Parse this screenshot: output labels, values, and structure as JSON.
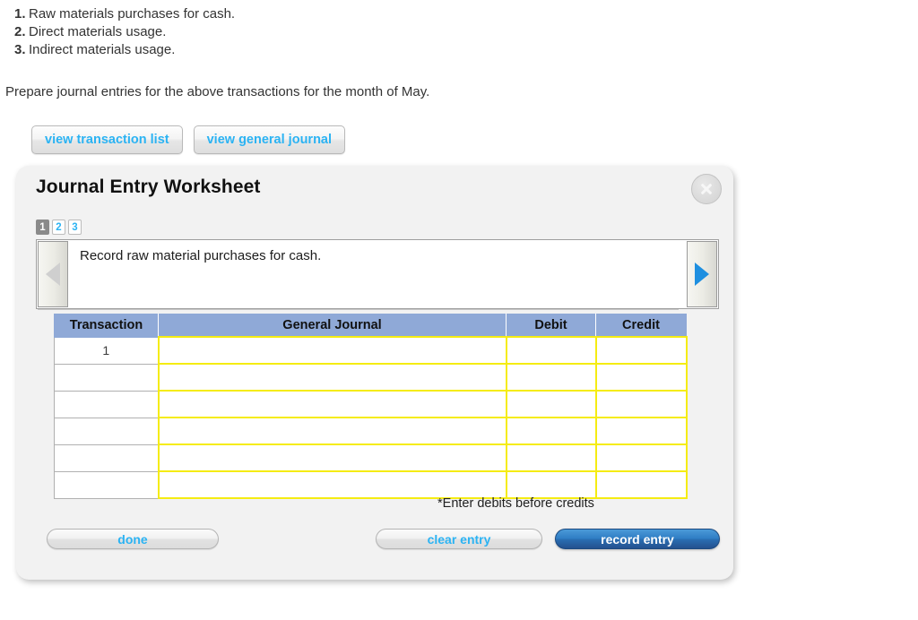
{
  "question": {
    "items": [
      {
        "num": "1.",
        "text": "Raw materials purchases for cash."
      },
      {
        "num": "2.",
        "text": "Direct materials usage."
      },
      {
        "num": "3.",
        "text": "Indirect materials usage."
      }
    ],
    "prompt": "Prepare journal entries for the above transactions for the month of May."
  },
  "view_buttons": {
    "transaction_list": "view transaction list",
    "general_journal": "view general journal"
  },
  "worksheet": {
    "title": "Journal Entry Worksheet",
    "close_icon": "close-circle-icon",
    "step_tabs": [
      {
        "label": "1",
        "state": "active"
      },
      {
        "label": "2",
        "state": "inactive"
      },
      {
        "label": "3",
        "state": "inactive"
      }
    ],
    "navigator": {
      "prev_icon": "triangle-left-icon",
      "next_icon": "triangle-right-icon",
      "prev_state": "disabled",
      "next_state": "enabled",
      "instruction": "Record raw material purchases for cash."
    },
    "table": {
      "headers": [
        "Transaction",
        "General Journal",
        "Debit",
        "Credit"
      ],
      "rows": [
        {
          "transaction": "1",
          "general_journal": "",
          "debit": "",
          "credit": ""
        },
        {
          "transaction": "",
          "general_journal": "",
          "debit": "",
          "credit": ""
        },
        {
          "transaction": "",
          "general_journal": "",
          "debit": "",
          "credit": ""
        },
        {
          "transaction": "",
          "general_journal": "",
          "debit": "",
          "credit": ""
        },
        {
          "transaction": "",
          "general_journal": "",
          "debit": "",
          "credit": ""
        },
        {
          "transaction": "",
          "general_journal": "",
          "debit": "",
          "credit": ""
        }
      ]
    },
    "footnote": "*Enter debits before credits",
    "footer": {
      "done": "done",
      "clear_entry": "clear entry",
      "record_entry": "record entry"
    }
  },
  "colors": {
    "accent_blue": "#2bb3f3",
    "header_blue": "#8fa9d7",
    "input_yellow": "#f5ec12",
    "record_button_blue": "#2f7dc4",
    "panel_bg": "#f2f2f2"
  }
}
